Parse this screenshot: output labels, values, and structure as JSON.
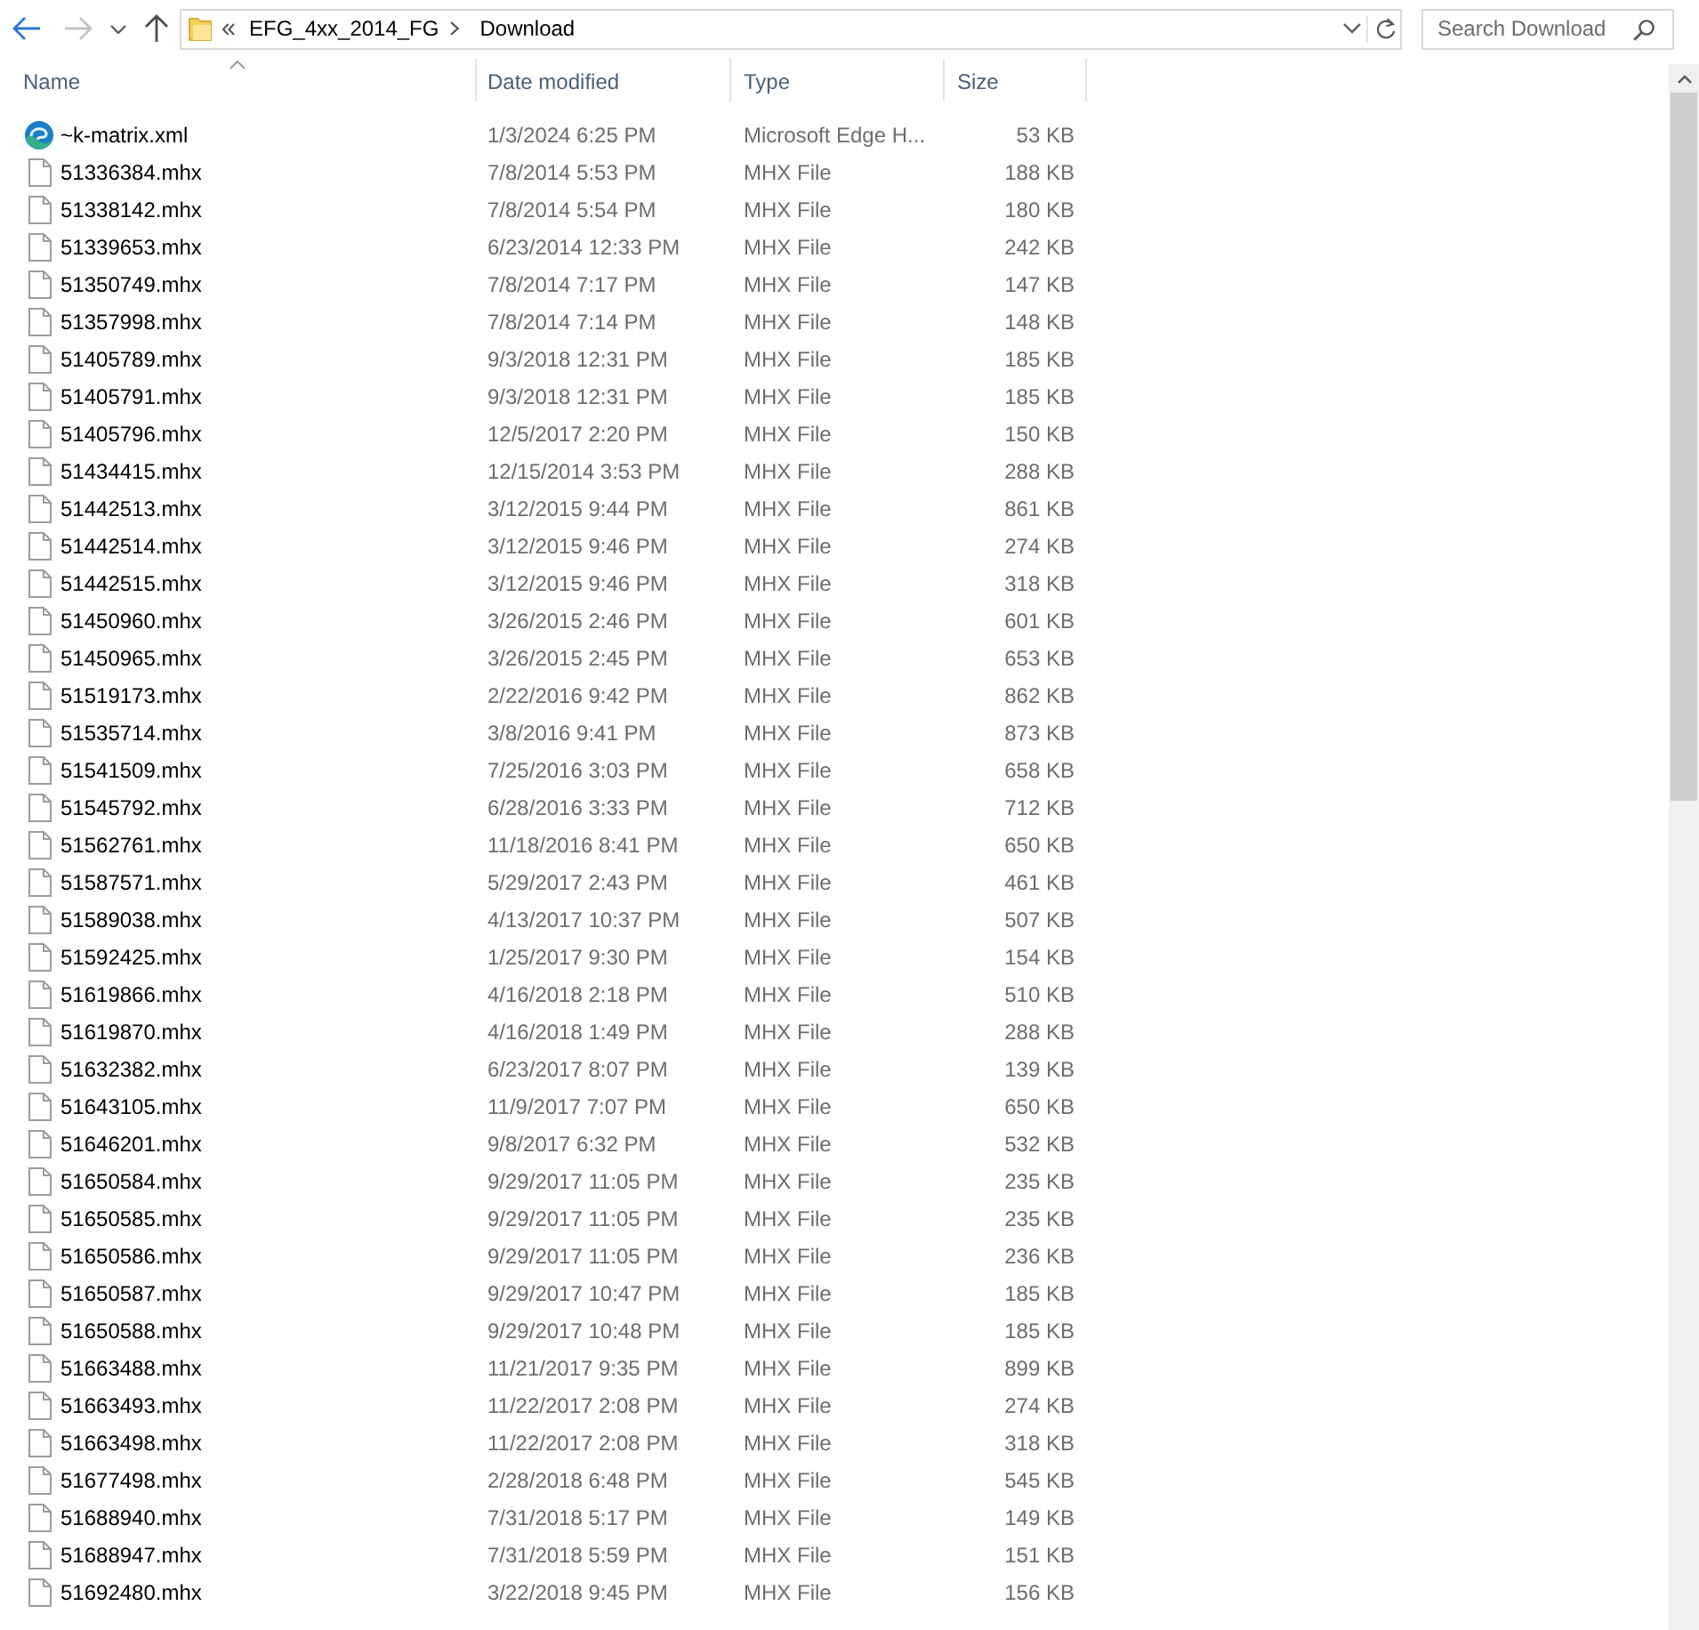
{
  "navigation": [
    {
      "kind": "back",
      "disabled": false
    },
    {
      "kind": "forward",
      "disabled": true
    },
    {
      "kind": "recent",
      "disabled": false
    },
    {
      "kind": "up",
      "disabled": false
    }
  ],
  "address_bar": {
    "crumbs": [
      "EFG_4xx_2014_FG",
      "Download"
    ]
  },
  "search": {
    "placeholder": "Search Download"
  },
  "columns": [
    {
      "label": "Name",
      "sorted": true
    },
    {
      "label": "Date modified",
      "sorted": false
    },
    {
      "label": "Type",
      "sorted": false
    },
    {
      "label": "Size",
      "sorted": false
    }
  ],
  "files": [
    {
      "kind": "browser",
      "name": "~k-matrix.xml",
      "date": "1/3/2024 6:25 PM",
      "type": "Microsoft Edge H...",
      "size": "53 KB"
    },
    {
      "kind": "document",
      "name": "51336384.mhx",
      "date": "7/8/2014 5:53 PM",
      "type": "MHX File",
      "size": "188 KB"
    },
    {
      "kind": "document",
      "name": "51338142.mhx",
      "date": "7/8/2014 5:54 PM",
      "type": "MHX File",
      "size": "180 KB"
    },
    {
      "kind": "document",
      "name": "51339653.mhx",
      "date": "6/23/2014 12:33 PM",
      "type": "MHX File",
      "size": "242 KB"
    },
    {
      "kind": "document",
      "name": "51350749.mhx",
      "date": "7/8/2014 7:17 PM",
      "type": "MHX File",
      "size": "147 KB"
    },
    {
      "kind": "document",
      "name": "51357998.mhx",
      "date": "7/8/2014 7:14 PM",
      "type": "MHX File",
      "size": "148 KB"
    },
    {
      "kind": "document",
      "name": "51405789.mhx",
      "date": "9/3/2018 12:31 PM",
      "type": "MHX File",
      "size": "185 KB"
    },
    {
      "kind": "document",
      "name": "51405791.mhx",
      "date": "9/3/2018 12:31 PM",
      "type": "MHX File",
      "size": "185 KB"
    },
    {
      "kind": "document",
      "name": "51405796.mhx",
      "date": "12/5/2017 2:20 PM",
      "type": "MHX File",
      "size": "150 KB"
    },
    {
      "kind": "document",
      "name": "51434415.mhx",
      "date": "12/15/2014 3:53 PM",
      "type": "MHX File",
      "size": "288 KB"
    },
    {
      "kind": "document",
      "name": "51442513.mhx",
      "date": "3/12/2015 9:44 PM",
      "type": "MHX File",
      "size": "861 KB"
    },
    {
      "kind": "document",
      "name": "51442514.mhx",
      "date": "3/12/2015 9:46 PM",
      "type": "MHX File",
      "size": "274 KB"
    },
    {
      "kind": "document",
      "name": "51442515.mhx",
      "date": "3/12/2015 9:46 PM",
      "type": "MHX File",
      "size": "318 KB"
    },
    {
      "kind": "document",
      "name": "51450960.mhx",
      "date": "3/26/2015 2:46 PM",
      "type": "MHX File",
      "size": "601 KB"
    },
    {
      "kind": "document",
      "name": "51450965.mhx",
      "date": "3/26/2015 2:45 PM",
      "type": "MHX File",
      "size": "653 KB"
    },
    {
      "kind": "document",
      "name": "51519173.mhx",
      "date": "2/22/2016 9:42 PM",
      "type": "MHX File",
      "size": "862 KB"
    },
    {
      "kind": "document",
      "name": "51535714.mhx",
      "date": "3/8/2016 9:41 PM",
      "type": "MHX File",
      "size": "873 KB"
    },
    {
      "kind": "document",
      "name": "51541509.mhx",
      "date": "7/25/2016 3:03 PM",
      "type": "MHX File",
      "size": "658 KB"
    },
    {
      "kind": "document",
      "name": "51545792.mhx",
      "date": "6/28/2016 3:33 PM",
      "type": "MHX File",
      "size": "712 KB"
    },
    {
      "kind": "document",
      "name": "51562761.mhx",
      "date": "11/18/2016 8:41 PM",
      "type": "MHX File",
      "size": "650 KB"
    },
    {
      "kind": "document",
      "name": "51587571.mhx",
      "date": "5/29/2017 2:43 PM",
      "type": "MHX File",
      "size": "461 KB"
    },
    {
      "kind": "document",
      "name": "51589038.mhx",
      "date": "4/13/2017 10:37 PM",
      "type": "MHX File",
      "size": "507 KB"
    },
    {
      "kind": "document",
      "name": "51592425.mhx",
      "date": "1/25/2017 9:30 PM",
      "type": "MHX File",
      "size": "154 KB"
    },
    {
      "kind": "document",
      "name": "51619866.mhx",
      "date": "4/16/2018 2:18 PM",
      "type": "MHX File",
      "size": "510 KB"
    },
    {
      "kind": "document",
      "name": "51619870.mhx",
      "date": "4/16/2018 1:49 PM",
      "type": "MHX File",
      "size": "288 KB"
    },
    {
      "kind": "document",
      "name": "51632382.mhx",
      "date": "6/23/2017 8:07 PM",
      "type": "MHX File",
      "size": "139 KB"
    },
    {
      "kind": "document",
      "name": "51643105.mhx",
      "date": "11/9/2017 7:07 PM",
      "type": "MHX File",
      "size": "650 KB"
    },
    {
      "kind": "document",
      "name": "51646201.mhx",
      "date": "9/8/2017 6:32 PM",
      "type": "MHX File",
      "size": "532 KB"
    },
    {
      "kind": "document",
      "name": "51650584.mhx",
      "date": "9/29/2017 11:05 PM",
      "type": "MHX File",
      "size": "235 KB"
    },
    {
      "kind": "document",
      "name": "51650585.mhx",
      "date": "9/29/2017 11:05 PM",
      "type": "MHX File",
      "size": "235 KB"
    },
    {
      "kind": "document",
      "name": "51650586.mhx",
      "date": "9/29/2017 11:05 PM",
      "type": "MHX File",
      "size": "236 KB"
    },
    {
      "kind": "document",
      "name": "51650587.mhx",
      "date": "9/29/2017 10:47 PM",
      "type": "MHX File",
      "size": "185 KB"
    },
    {
      "kind": "document",
      "name": "51650588.mhx",
      "date": "9/29/2017 10:48 PM",
      "type": "MHX File",
      "size": "185 KB"
    },
    {
      "kind": "document",
      "name": "51663488.mhx",
      "date": "11/21/2017 9:35 PM",
      "type": "MHX File",
      "size": "899 KB"
    },
    {
      "kind": "document",
      "name": "51663493.mhx",
      "date": "11/22/2017 2:08 PM",
      "type": "MHX File",
      "size": "274 KB"
    },
    {
      "kind": "document",
      "name": "51663498.mhx",
      "date": "11/22/2017 2:08 PM",
      "type": "MHX File",
      "size": "318 KB"
    },
    {
      "kind": "document",
      "name": "51677498.mhx",
      "date": "2/28/2018 6:48 PM",
      "type": "MHX File",
      "size": "545 KB"
    },
    {
      "kind": "document",
      "name": "51688940.mhx",
      "date": "7/31/2018 5:17 PM",
      "type": "MHX File",
      "size": "149 KB"
    },
    {
      "kind": "document",
      "name": "51688947.mhx",
      "date": "7/31/2018 5:59 PM",
      "type": "MHX File",
      "size": "151 KB"
    },
    {
      "kind": "document",
      "name": "51692480.mhx",
      "date": "3/22/2018 9:45 PM",
      "type": "MHX File",
      "size": "156 KB"
    }
  ]
}
